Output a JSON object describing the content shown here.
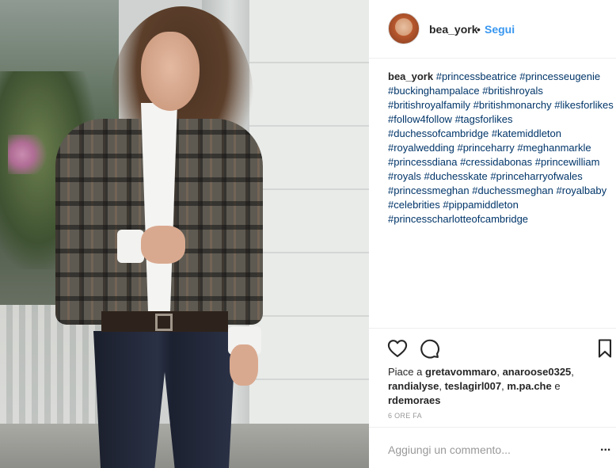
{
  "post": {
    "photo_alt": "",
    "header": {
      "username": "bea_york",
      "separator": "•",
      "follow_label": "Segui"
    },
    "caption": {
      "username": "bea_york",
      "tags": [
        "#princessbeatrice",
        "#princesseugenie",
        "#buckinghampalace",
        "#britishroyals",
        "#britishroyalfamily",
        "#britishmonarchy",
        "#likesforlikes",
        "#follow4follow",
        "#tagsforlikes",
        "#duchessofcambridge",
        "#katemiddleton",
        "#royalwedding",
        "#princeharry",
        "#meghanmarkle",
        "#princessdiana",
        "#cressidabonas",
        "#princewilliam",
        "#royals",
        "#duchesskate",
        "#princeharryofwales",
        "#princessmeghan",
        "#duchessmeghan",
        "#royalbaby",
        "#celebrities",
        "#pippamiddleton",
        "#princesscharlotteofcambridge"
      ]
    },
    "likes": {
      "prefix": "Piace a",
      "users": [
        "gretavommaro",
        "anaroose0325",
        "randialyse",
        "teslagirl007",
        "m.pa.che",
        "rdemoraes"
      ],
      "sep1": ",",
      "sep2": ",",
      "sep3": ",",
      "sep4": ",",
      "conj": "e"
    },
    "timestamp": "6 ORE FA",
    "comment": {
      "placeholder": "Aggiungi un commento...",
      "more_label": "..."
    },
    "icons": {
      "like": "heart-icon",
      "comment": "comment-icon",
      "save": "bookmark-icon"
    }
  }
}
